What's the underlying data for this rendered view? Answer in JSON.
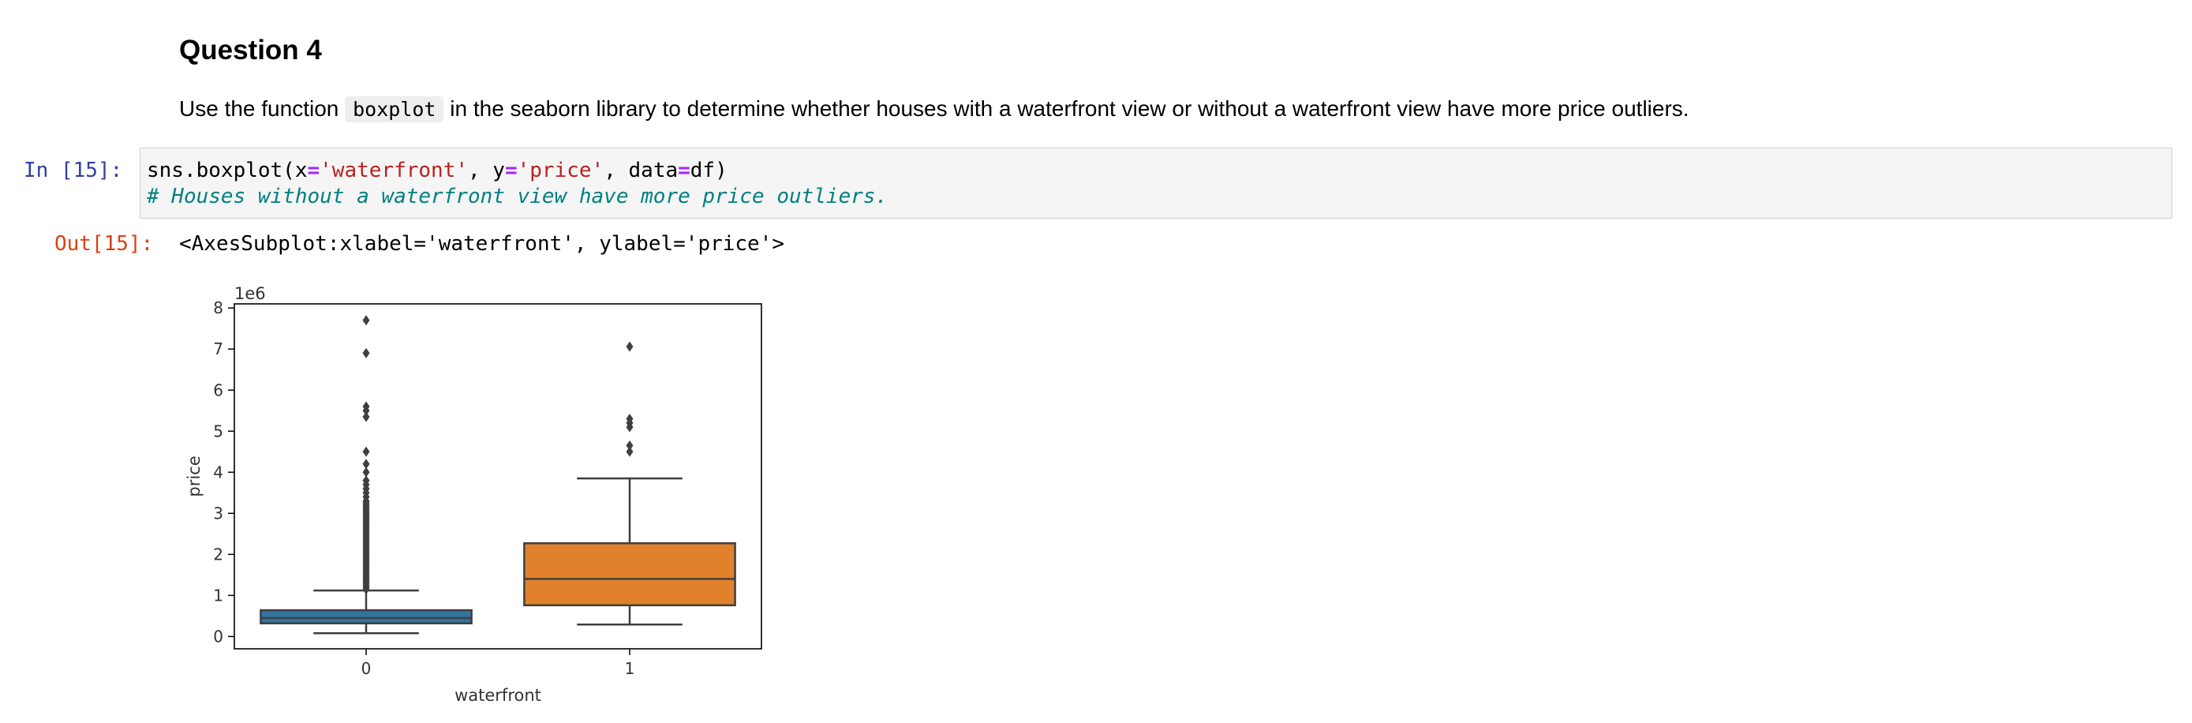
{
  "markdown": {
    "heading": "Question 4",
    "para_before": "Use the function ",
    "para_code": "boxplot",
    "para_after": " in the seaborn library to determine whether houses with a waterfront view or without a waterfront view have more price outliers."
  },
  "input_cell": {
    "prompt": "In [15]:",
    "code": {
      "fn": "sns.boxplot(x",
      "eq1": "=",
      "str1": "'waterfront'",
      "mid1": ", y",
      "eq2": "=",
      "str2": "'price'",
      "mid2": ", data",
      "eq3": "=",
      "tail": "df)"
    },
    "comment": "# Houses without a waterfront view have more price outliers."
  },
  "output_cell": {
    "prompt": "Out[15]:",
    "text": "<AxesSubplot:xlabel='waterfront', ylabel='price'>"
  },
  "chart_data": {
    "type": "box",
    "xlabel": "waterfront",
    "ylabel": "price",
    "offset_label": "1e6",
    "ylim": [
      -0.3,
      8.1
    ],
    "yticks": [
      0,
      1,
      2,
      3,
      4,
      5,
      6,
      7,
      8
    ],
    "categories": [
      "0",
      "1"
    ],
    "colors": [
      "#3274a1",
      "#e1812c"
    ],
    "edge_color": "#3f3f3f",
    "boxes": [
      {
        "category": "0",
        "whisker_low": 0.08,
        "q1": 0.32,
        "median": 0.45,
        "q3": 0.64,
        "whisker_high": 1.12,
        "outliers": [
          1.15,
          1.2,
          1.25,
          1.3,
          1.35,
          1.4,
          1.45,
          1.5,
          1.55,
          1.6,
          1.65,
          1.7,
          1.75,
          1.8,
          1.85,
          1.9,
          1.95,
          2.0,
          2.05,
          2.1,
          2.15,
          2.2,
          2.25,
          2.3,
          2.35,
          2.4,
          2.45,
          2.5,
          2.55,
          2.6,
          2.65,
          2.7,
          2.75,
          2.8,
          2.85,
          2.9,
          2.95,
          3.0,
          3.05,
          3.1,
          3.15,
          3.2,
          3.25,
          3.3,
          3.4,
          3.5,
          3.6,
          3.7,
          3.8,
          4.0,
          4.2,
          4.5,
          5.35,
          5.5,
          5.6,
          6.9,
          7.7
        ]
      },
      {
        "category": "1",
        "whisker_low": 0.29,
        "q1": 0.76,
        "median": 1.4,
        "q3": 2.27,
        "whisker_high": 3.85,
        "outliers": [
          4.5,
          4.65,
          5.1,
          5.2,
          5.3,
          7.06
        ]
      }
    ]
  }
}
